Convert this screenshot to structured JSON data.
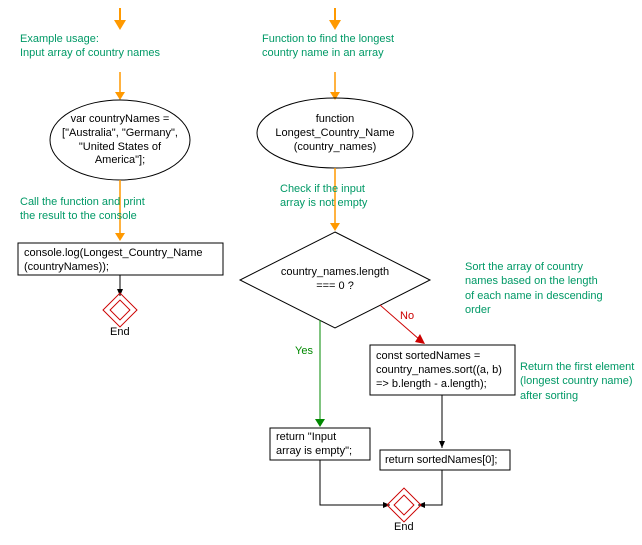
{
  "chart_data": [
    {
      "type": "flowchart",
      "title": "Example usage flow",
      "nodes": [
        {
          "id": "start1",
          "shape": "start-arrow"
        },
        {
          "id": "var",
          "shape": "terminator",
          "text": "var countryNames = [\"Australia\", \"Germany\", \"United States of America\"];"
        },
        {
          "id": "log",
          "shape": "process",
          "text": "console.log(Longest_Country_Name(countryNames));"
        },
        {
          "id": "end1",
          "shape": "end",
          "text": "End"
        }
      ],
      "edges": [
        {
          "from": "start1",
          "to": "var"
        },
        {
          "from": "var",
          "to": "log"
        },
        {
          "from": "log",
          "to": "end1"
        }
      ]
    },
    {
      "type": "flowchart",
      "title": "Function flow",
      "nodes": [
        {
          "id": "start2",
          "shape": "start-arrow"
        },
        {
          "id": "func",
          "shape": "terminator",
          "text": "function Longest_Country_Name (country_names)"
        },
        {
          "id": "decision",
          "shape": "decision",
          "text": "country_names.length === 0 ?"
        },
        {
          "id": "sort",
          "shape": "process",
          "text": "const sortedNames = country_names.sort((a, b) => b.length - a.length);"
        },
        {
          "id": "retEmpty",
          "shape": "process",
          "text": "return \"Input array is empty\";"
        },
        {
          "id": "retFirst",
          "shape": "process",
          "text": "return sortedNames[0];"
        },
        {
          "id": "end2",
          "shape": "end",
          "text": "End"
        }
      ],
      "edges": [
        {
          "from": "start2",
          "to": "func"
        },
        {
          "from": "func",
          "to": "decision"
        },
        {
          "from": "decision",
          "to": "retEmpty",
          "label": "Yes"
        },
        {
          "from": "decision",
          "to": "sort",
          "label": "No"
        },
        {
          "from": "sort",
          "to": "retFirst"
        },
        {
          "from": "retEmpty",
          "to": "end2"
        },
        {
          "from": "retFirst",
          "to": "end2"
        }
      ]
    }
  ],
  "annotations": {
    "a1": "Example usage:\nInput array of country names",
    "a2": "Call the function and print\nthe result to the console",
    "a3": "Function to find the longest\ncountry name in an array",
    "a4": "Check if the input\narray is not empty",
    "a5": "Sort the array of country\nnames based on the length\nof each name in descending\norder",
    "a6": "Return the first element\n(longest country name)\nafter sorting"
  },
  "nodes": {
    "varDecl": "var countryNames =\n[\"Australia\", \"Germany\",\n\"United States of\nAmerica\"];",
    "consoleLog": "console.log(Longest_Country_Name\n(countryNames));",
    "funcDecl": "function\nLongest_Country_Name\n(country_names)",
    "decision": "country_names.length\n=== 0 ?",
    "sort": "const sortedNames =\ncountry_names.sort((a, b)\n=> b.length - a.length);",
    "retEmpty": "return \"Input\narray is empty\";",
    "retFirst": "return sortedNames[0];",
    "end": "End"
  },
  "labels": {
    "yes": "Yes",
    "no": "No"
  }
}
